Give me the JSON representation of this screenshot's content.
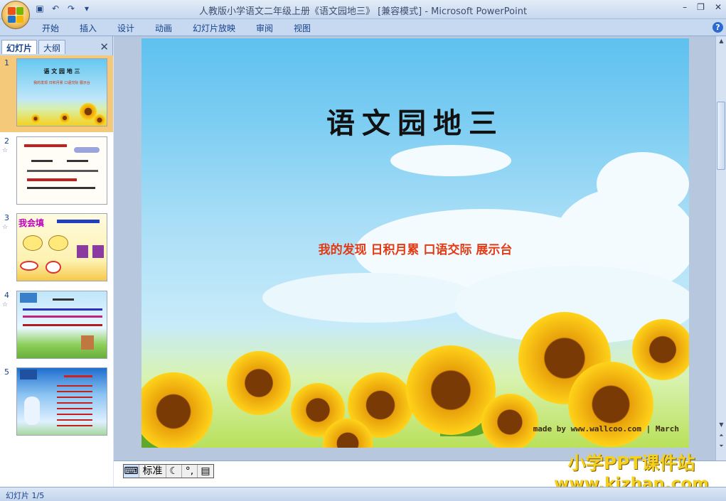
{
  "window": {
    "title": "人教版小学语文二年级上册《语文园地三》 [兼容模式] - Microsoft PowerPoint",
    "minimize": "–",
    "restore": "❐",
    "close": "✕"
  },
  "quick_access": {
    "save_icon": "save-icon",
    "undo_icon": "undo-icon",
    "redo_icon": "redo-icon",
    "customize_icon": "dropdown-icon"
  },
  "ribbon": {
    "tabs": [
      {
        "label": "开始"
      },
      {
        "label": "插入"
      },
      {
        "label": "设计"
      },
      {
        "label": "动画"
      },
      {
        "label": "幻灯片放映"
      },
      {
        "label": "审阅"
      },
      {
        "label": "视图"
      }
    ],
    "help": "?"
  },
  "left_panel": {
    "tab_slides": "幻灯片",
    "tab_outline": "大纲",
    "close": "✕",
    "thumbnails": [
      {
        "num": "1",
        "title": "语 文 园 地 三",
        "subtitle": "我的发现 日积月累 口语交际 展示台",
        "selected": true
      },
      {
        "num": "2",
        "title": "",
        "subtitle": ""
      },
      {
        "num": "3",
        "title": "我会填",
        "subtitle": ""
      },
      {
        "num": "4",
        "title": "",
        "subtitle": ""
      },
      {
        "num": "5",
        "title": "",
        "subtitle": ""
      }
    ]
  },
  "slide": {
    "title": "语文园地三",
    "subtitle": "我的发现  日积月累  口语交际  展示台",
    "credit": "made by www.wallcoo.com | March"
  },
  "notes": {
    "ime_label": "标准",
    "ime_icon": "ime-logo-icon"
  },
  "watermark": {
    "line1": "小学PPT课件站",
    "line2": "www.kjzhan.com"
  },
  "status": {
    "slide_info": "幻灯片 1/5"
  },
  "colors": {
    "subtitle": "#e23a12",
    "ribbon": "#c6d9f1",
    "watermark": "#f4d020"
  }
}
